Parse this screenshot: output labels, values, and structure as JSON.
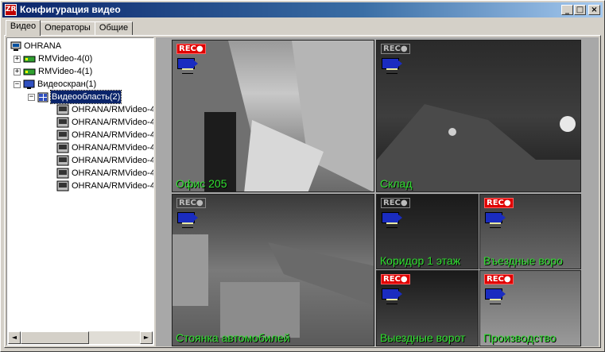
{
  "window": {
    "title": "Конфигурация видео",
    "app_icon": "ZR"
  },
  "controls": {
    "minimize": "_",
    "maximize": "□",
    "close": "×"
  },
  "tabs": [
    {
      "label": "Видео",
      "active": true
    },
    {
      "label": "Операторы",
      "active": false
    },
    {
      "label": "Общие",
      "active": false
    }
  ],
  "tree": {
    "root": "OHRANA",
    "items": [
      {
        "label": "RMVideo-4(0)",
        "expander": "+"
      },
      {
        "label": "RMVideo-4(1)",
        "expander": "+"
      },
      {
        "label": "Видеоскран(1)",
        "expander": "−"
      },
      {
        "label": "Видеообласть(2)",
        "expander": "−"
      }
    ],
    "leaves": [
      "OHRANA/RMVideo-4",
      "OHRANA/RMVideo-4",
      "OHRANA/RMVideo-4",
      "OHRANA/RMVideo-4",
      "OHRANA/RMVideo-4",
      "OHRANA/RMVideo-4",
      "OHRANA/RMVideo-4"
    ]
  },
  "scrollbar": {
    "left_arrow": "◄",
    "right_arrow": "►"
  },
  "cameras": [
    {
      "name": "Офис 205",
      "rec": "REC●",
      "recording": true
    },
    {
      "name": "Склад",
      "rec": "REC●",
      "recording": false
    },
    {
      "name": "Стоянка автомобилей",
      "rec": "REC●",
      "recording": false
    },
    {
      "name": "Коридор 1 этаж",
      "rec": "REC●",
      "recording": false
    },
    {
      "name": "Въездные воро",
      "rec": "REC●",
      "recording": true
    },
    {
      "name": "Выездные ворот",
      "rec": "REC●",
      "recording": true
    },
    {
      "name": "Производство",
      "rec": "REC●",
      "recording": true
    }
  ]
}
